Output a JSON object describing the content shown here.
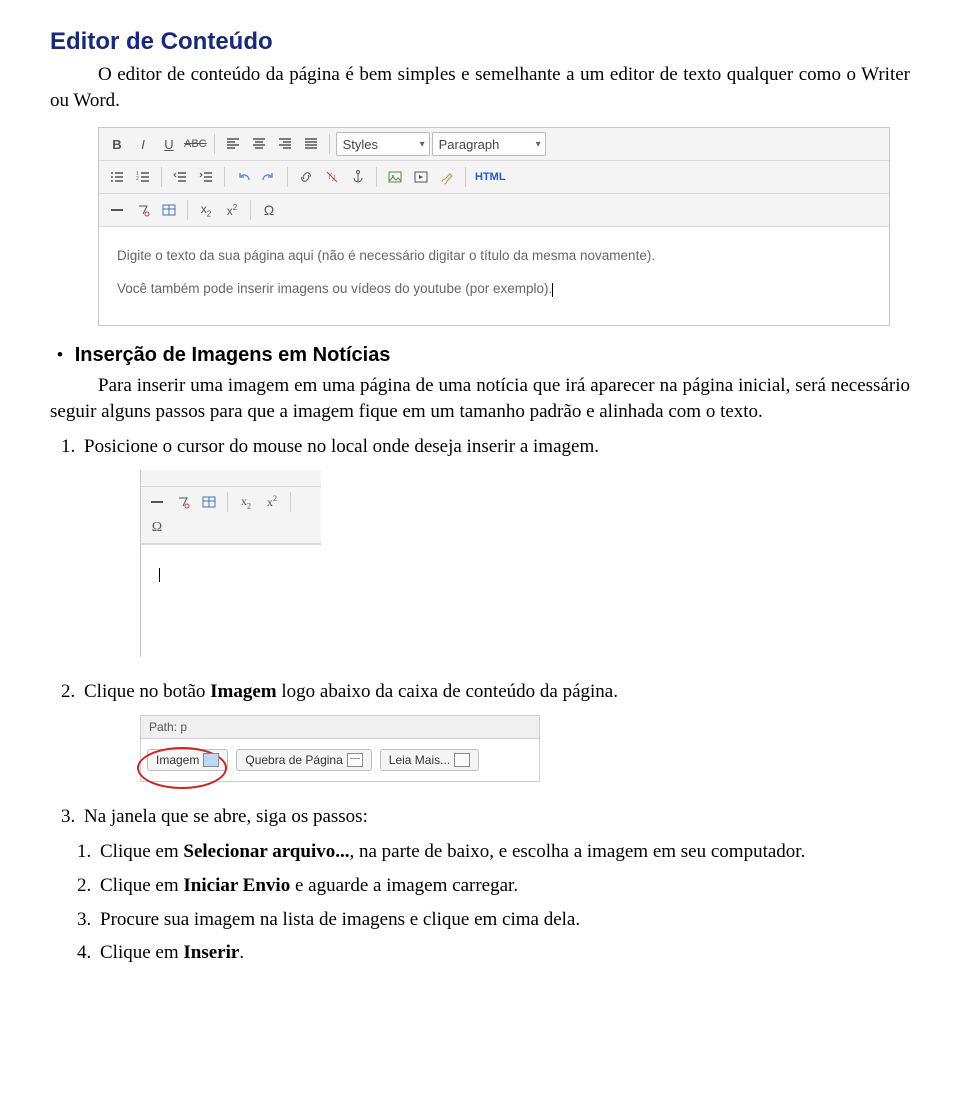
{
  "heading": "Editor de Conteúdo",
  "intro": "O editor de conteúdo da página é bem simples e semelhante a um editor de texto qualquer como o Writer ou Word.",
  "editor1": {
    "styles_label": "Styles",
    "paragraph_label": "Paragraph",
    "html_label": "HTML",
    "body_line1": "Digite o texto da sua página aqui (não é necessário digitar o título da mesma novamente).",
    "body_line2": "Você também pode inserir imagens ou vídeos do youtube (por exemplo)."
  },
  "section2": {
    "title": "Inserção de Imagens em Notícias",
    "para": "Para inserir uma imagem em uma página de uma notícia que irá aparecer na página inicial, será necessário seguir alguns passos para que a imagem fique em um tamanho padrão e alinhada com o texto.",
    "step1": "Posicione o cursor do mouse no local onde deseja inserir a imagem.",
    "step2_a": "Clique no botão ",
    "step2_b": "Imagem",
    "step2_c": " logo abaixo da caixa de conteúdo da página."
  },
  "footer_bar": {
    "path_label": "Path: p",
    "btn_imagem": "Imagem",
    "btn_quebra": "Quebra de Página",
    "btn_leia": "Leia Mais..."
  },
  "section3": {
    "step3": "Na janela que se abre, siga os passos:",
    "sub1_a": "Clique em ",
    "sub1_b": "Selecionar arquivo...",
    "sub1_c": ", na parte de baixo, e escolha a imagem em seu computador.",
    "sub2_a": "Clique em ",
    "sub2_b": "Iniciar Envio",
    "sub2_c": " e aguarde a imagem carregar.",
    "sub3": "Procure sua imagem na lista de imagens e clique em cima dela.",
    "sub4_a": "Clique em ",
    "sub4_b": "Inserir",
    "sub4_c": "."
  }
}
